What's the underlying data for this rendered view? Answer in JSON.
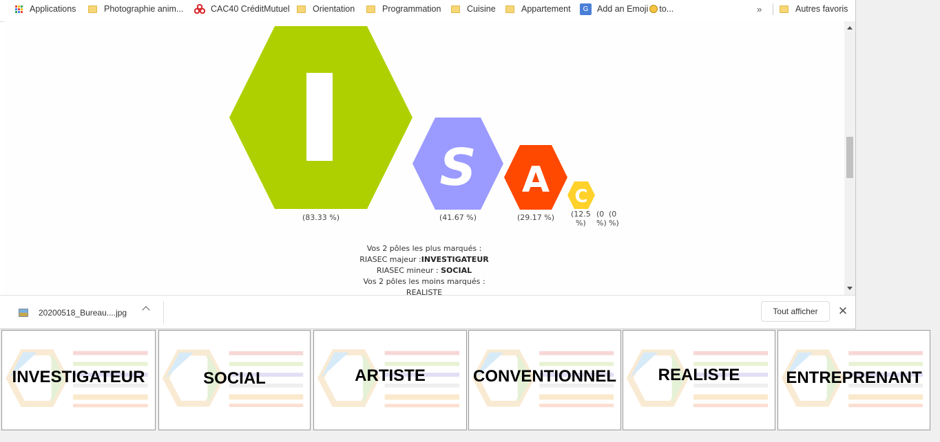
{
  "bookmarks": {
    "items": [
      {
        "label": "Applications",
        "icon": "apps-grid-icon"
      },
      {
        "label": "Photographie anim...",
        "icon": "folder-icon"
      },
      {
        "label": "CAC40 CréditMutuel",
        "icon": "creditmutuel-logo-icon"
      },
      {
        "label": "Orientation",
        "icon": "folder-icon"
      },
      {
        "label": "Programmation",
        "icon": "folder-icon"
      },
      {
        "label": "Cuisine",
        "icon": "folder-icon"
      },
      {
        "label": "Appartement",
        "icon": "folder-icon"
      },
      {
        "label": "Add an Emoji",
        "suffix": "to...",
        "icon": "google-translate-icon"
      }
    ],
    "more": "»",
    "other": "Autres favoris"
  },
  "riasec": {
    "hexagons": [
      {
        "letter": "I",
        "percent": "(83.33 %)",
        "color": "#afd000"
      },
      {
        "letter": "S",
        "percent": "(41.67 %)",
        "color": "#9a9aff"
      },
      {
        "letter": "A",
        "percent": "(29.17 %)",
        "color": "#ff4800"
      },
      {
        "letter": "C",
        "percent_line1": "(12.5",
        "percent_line2": "%)",
        "color": "#ffd12a"
      }
    ],
    "zero_a_line1": "(0",
    "zero_a_line2": "%)",
    "zero_b_line1": "(0",
    "zero_b_line2": "%)"
  },
  "summary": {
    "line1": "Vos 2 pôles les plus marqués :",
    "major_label": "RIASEC majeur :",
    "major_value": "INVESTIGATEUR",
    "minor_label": "RIASEC mineur : ",
    "minor_value": "SOCIAL",
    "line4": "Vos 2 pôles les moins marqués :",
    "line5": "REALISTE"
  },
  "downloads": {
    "file_name": "20200518_Bureau....jpg",
    "show_all": "Tout afficher",
    "close": "✕"
  },
  "tiles": [
    "INVESTIGATEUR",
    "SOCIAL",
    "ARTISTE",
    "CONVENTIONNEL",
    "REALISTE",
    "ENTREPRENANT"
  ]
}
